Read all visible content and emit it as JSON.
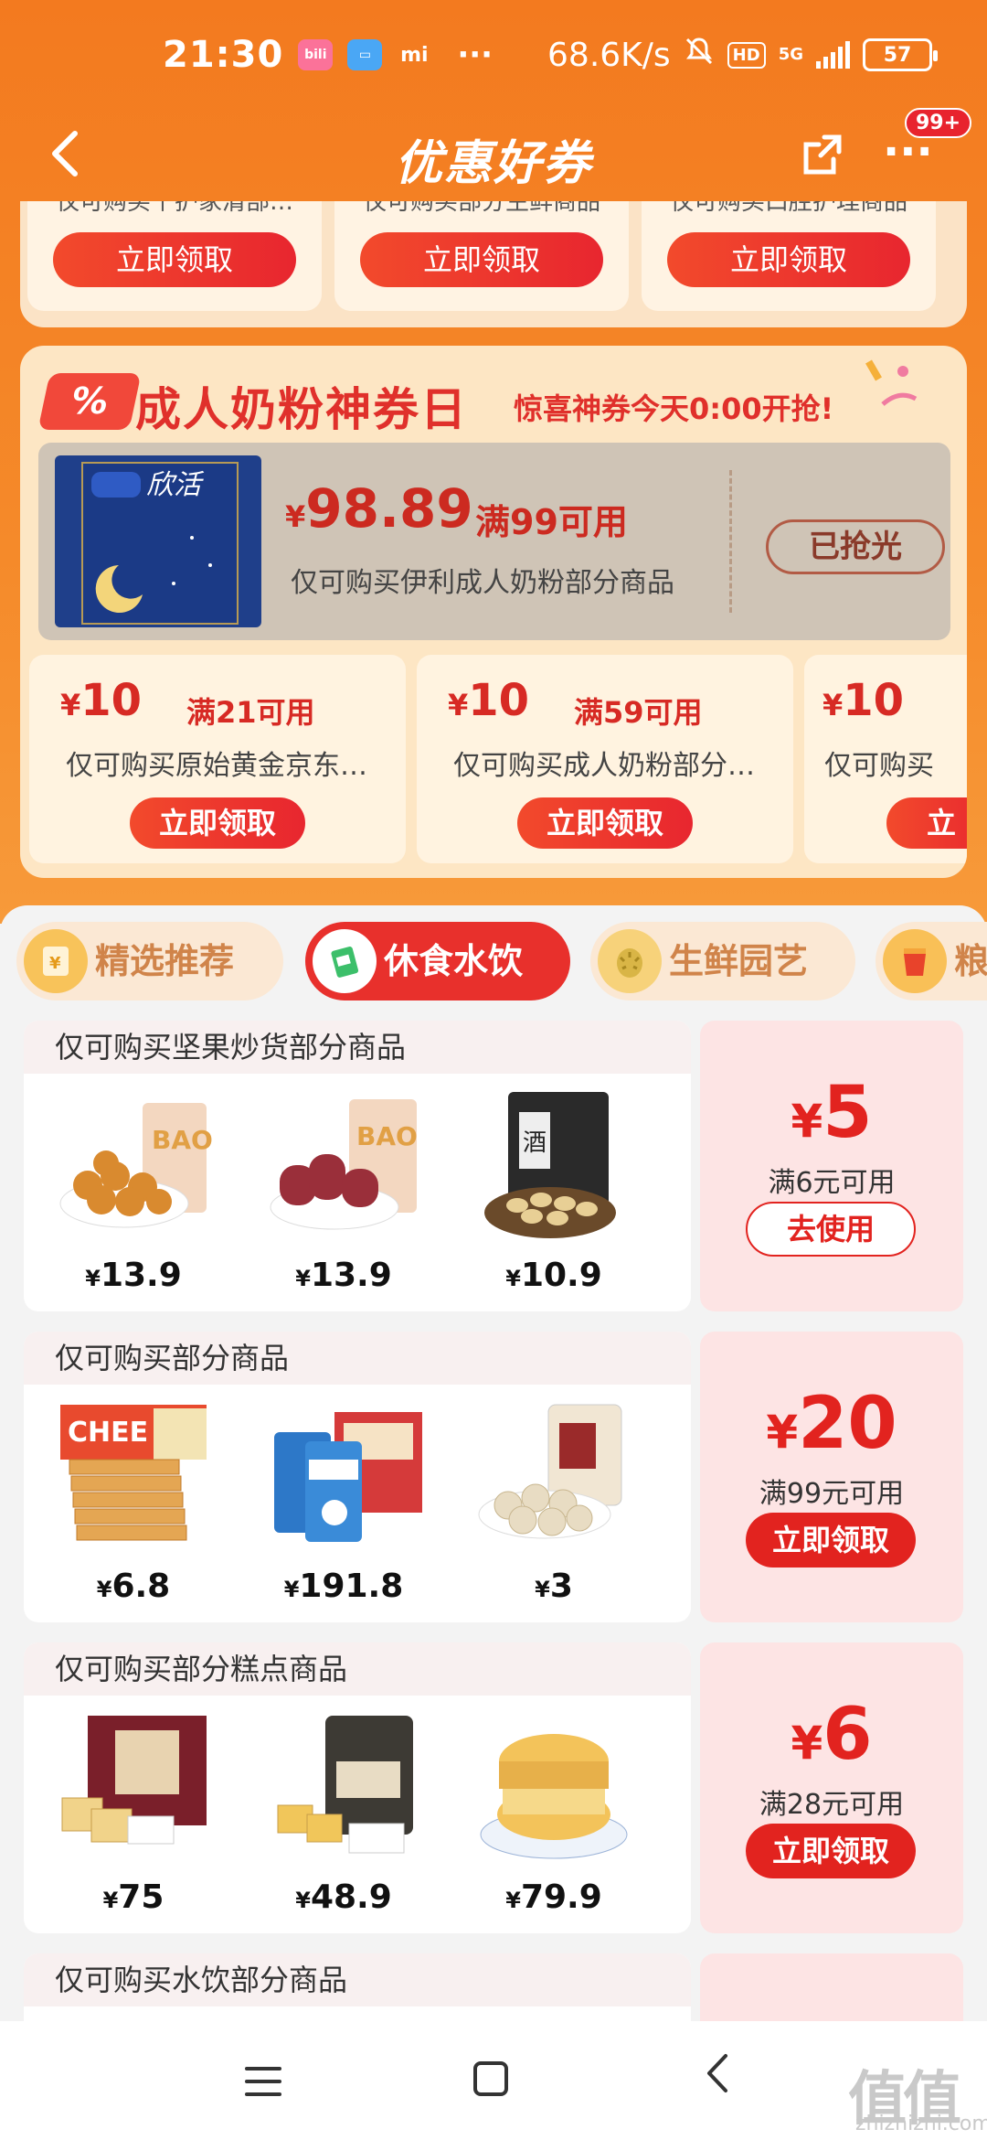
{
  "status_bar": {
    "time": "21:30",
    "apps": [
      {
        "icon": "bilibili-icon",
        "label": "bili",
        "color": "#fb7299"
      },
      {
        "icon": "wallet-icon",
        "label": "▭",
        "color": "#4aa7f5"
      },
      {
        "icon": "mi-icon",
        "label": "mi",
        "color": "#ff6900"
      }
    ],
    "dots": "···",
    "speed": "68.6K/s",
    "hd": "HD",
    "network": "5G",
    "battery": "57"
  },
  "nav": {
    "back_icon": "‹",
    "title": "优惠好券",
    "more_icon": "···",
    "badge": "99+"
  },
  "top_coupons": [
    {
      "desc": "仅可购买个护家清部…",
      "button": "立即领取"
    },
    {
      "desc": "仅可购买部分生鲜商品",
      "button": "立即领取"
    },
    {
      "desc": "仅可购买口腔护理商品",
      "button": "立即领取"
    }
  ],
  "milk_section": {
    "icon_text": "%",
    "title": "成人奶粉神券日",
    "subtitle": "惊喜神券今天0:00开抢!",
    "main_coupon": {
      "image_brand": "欣活",
      "currency": "¥",
      "amount": "98.89",
      "condition": "满99可用",
      "desc": "仅可购买伊利成人奶粉部分商品",
      "button": "已抢光"
    },
    "small_coupons": [
      {
        "currency": "¥",
        "amount": "10",
        "condition": "满21可用",
        "desc": "仅可购买原始黄金京东…",
        "button": "立即领取"
      },
      {
        "currency": "¥",
        "amount": "10",
        "condition": "满59可用",
        "desc": "仅可购买成人奶粉部分…",
        "button": "立即领取"
      },
      {
        "currency": "¥",
        "amount": "10",
        "condition": "",
        "desc": "仅可购买",
        "button": "立"
      }
    ]
  },
  "tabs": [
    {
      "label": "精选推荐",
      "icon": "coupon-icon",
      "active": false
    },
    {
      "label": "休食水饮",
      "icon": "snack-icon",
      "active": true
    },
    {
      "label": "生鲜园艺",
      "icon": "durian-icon",
      "active": false
    },
    {
      "label": "粮",
      "icon": "grain-icon",
      "active": false
    }
  ],
  "coupon_rows": [
    {
      "header": "仅可购买坚果炒货部分商品",
      "products": [
        {
          "name": "nut-balls",
          "currency": "¥",
          "price": "13.9"
        },
        {
          "name": "fruit-rolls",
          "currency": "¥",
          "price": "13.9"
        },
        {
          "name": "peanuts",
          "currency": "¥",
          "price": "10.9"
        }
      ],
      "currency": "¥",
      "amount": "5",
      "condition": "满6元可用",
      "button": "去使用",
      "button_type": "use"
    },
    {
      "header": "仅可购买部分商品",
      "products": [
        {
          "name": "crackers",
          "currency": "¥",
          "price": "6.8"
        },
        {
          "name": "milk-powder-box",
          "currency": "¥",
          "price": "191.8"
        },
        {
          "name": "snack-balls",
          "currency": "¥",
          "price": "3"
        }
      ],
      "currency": "¥",
      "amount": "20",
      "condition": "满99元可用",
      "button": "立即领取",
      "button_type": "get"
    },
    {
      "header": "仅可购买部分糕点商品",
      "products": [
        {
          "name": "pastry-box",
          "currency": "¥",
          "price": "75"
        },
        {
          "name": "cake-bag",
          "currency": "¥",
          "price": "48.9"
        },
        {
          "name": "egg-tart",
          "currency": "¥",
          "price": "79.9"
        }
      ],
      "currency": "¥",
      "amount": "6",
      "condition": "满28元可用",
      "button": "立即领取",
      "button_type": "get"
    },
    {
      "header": "仅可购买水饮部分商品",
      "products": [],
      "currency": "",
      "amount": "",
      "condition": "",
      "button": "",
      "button_type": "get"
    }
  ],
  "watermark": {
    "main": "值值值",
    "sub": "zhizhizhi.com"
  },
  "colors": {
    "orange": "#f37a1f",
    "red": "#e2231f",
    "cream": "#fde6c4"
  }
}
